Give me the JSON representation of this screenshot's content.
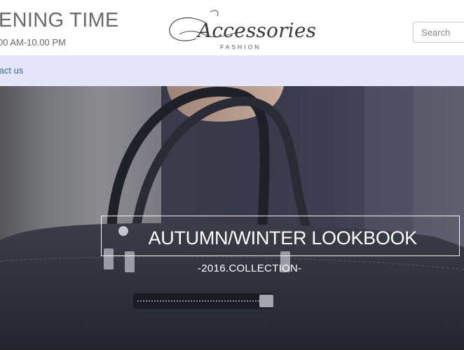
{
  "header": {
    "hours_title": "ENING TIME",
    "hours_time": "00 AM-10.00 PM",
    "logo": {
      "script": "Accessories",
      "subtitle": "FASHION"
    },
    "search": {
      "placeholder": "Search"
    }
  },
  "nav": {
    "contact_label": "tact us",
    "background": "#e6e6fa",
    "link_color": "#2e6da4"
  },
  "hero": {
    "title": "AUTUMN/WINTER LOOKBOOK",
    "subtitle": "-2016.COLLECTION-"
  },
  "icons": [
    "logo-flourish-icon"
  ]
}
